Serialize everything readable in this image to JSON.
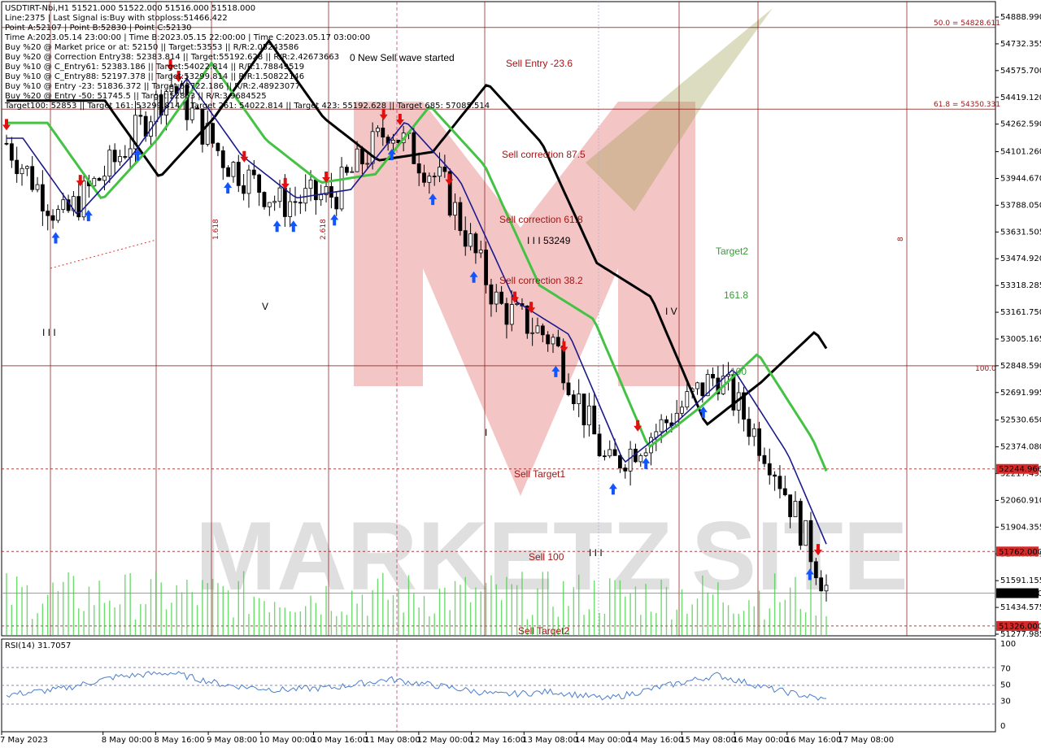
{
  "header": {
    "lines": [
      "USDTIRT-Nbi,H1  51521.000 51522.000 51516.000 51518.000",
      "Line:2375  | Last Signal is:Buy with stoploss:51466.422",
      "Point A:52107 | Point B:52830 | Point C:52130",
      "Time A:2023.05.14 23:00:00 | Time B:2023.05.15 22:00:00 | Time C:2023.05.17 03:00:00",
      "Buy %20 @ Market price or at: 52150 || Target:53553 || R/R:2.05243586",
      "Buy %20 @ Correction Entry38: 52383.814 || Target:55192.628 || R/R:2.42673663",
      "Buy %10 @ C_Entry61: 52383.186 || Target:54022.814 || R/R:1.78849519",
      "Buy %10 @ C_Entry88: 52197.378 || Target:53299.814 || R/R:1.50822146",
      "Buy %10 @ Entry -23: 51836.372 || Target:53722.186 || R/R:2.48923077",
      "Buy %20 @ Entry -50: 51745.5 || Target:52853 || R/R:3.9684525",
      "Target100: 52853 || Target 161: 53299.814 || Target 261: 54022.814 || Target 423: 55192.628 || Target 685: 57085.514"
    ]
  },
  "annotations": {
    "new_wave": "0 New Sell wave started",
    "sell_entry": "Sell Entry -23.6",
    "sell_corr_875": "Sell correction 87.5",
    "sell_corr_618": "Sell correction 61.8",
    "sell_corr_382": "Sell correction 38.2",
    "sell_target1": "Sell Target1",
    "sell_100": "Sell 100",
    "sell_target2": "Sell Target2",
    "target2": "Target2",
    "n1618": "161.8",
    "n100": "100",
    "wave_iii_price": "I I I 53249",
    "wave_iv": "I V",
    "wave_v": "V",
    "wave_iii_left": "I I I",
    "wave_i": "I",
    "wave_iii_bottom": "I I I",
    "fib_1618_vert": "1.618",
    "fib_2618_vert": "2.618",
    "num_8": "8",
    "fib_50": "50.0 = 54828.611",
    "fib_618": "61.8 = 54350.331",
    "fib_100": "100.0"
  },
  "watermark": {
    "text_left": "MARKETZ",
    "text_right": "SITE"
  },
  "price_axis": {
    "ticks": [
      "54888.990",
      "54732.355",
      "54575.700",
      "54419.120",
      "54262.590",
      "54101.260",
      "53944.670",
      "53788.050",
      "53631.505",
      "53474.920",
      "53318.285",
      "53161.750",
      "53005.165",
      "52848.590",
      "52691.995",
      "52530.650",
      "52374.080",
      "52217.495",
      "52060.910",
      "51904.355",
      "51747.785",
      "51591.155",
      "51434.575",
      "51277.985"
    ],
    "tags": [
      {
        "label": "52244.966",
        "color": "#d42a2a"
      },
      {
        "label": "51762.000",
        "color": "#d42a2a"
      },
      {
        "label": "51518.000",
        "color": "#000000"
      },
      {
        "label": "51326.000",
        "color": "#d42a2a"
      }
    ]
  },
  "time_axis": {
    "ticks": [
      "7 May 2023",
      "8 May 00:00",
      "8 May 16:00",
      "9 May 08:00",
      "10 May 00:00",
      "10 May 16:00",
      "11 May 08:00",
      "12 May 00:00",
      "12 May 16:00",
      "13 May 08:00",
      "14 May 00:00",
      "14 May 16:00",
      "15 May 08:00",
      "16 May 00:00",
      "16 May 16:00",
      "17 May 08:00"
    ]
  },
  "rsi": {
    "label": "RSI(14) 31.7057",
    "ticks": [
      "100",
      "70",
      "50",
      "30",
      "0"
    ]
  },
  "colors": {
    "ema_fast": "#1a1a8c",
    "ema_mid": "#44c244",
    "ema_slow": "#000000",
    "fib_line": "#8b1a1a",
    "rsi_line": "#4a7ecc",
    "volume": "#33cc33",
    "buy_arrow": "#1155ff",
    "sell_arrow": "#e01010"
  },
  "chart_data": [
    {
      "type": "line",
      "title": "USDTIRT-Nbi,H1",
      "ylim": [
        51277.985,
        54888.99
      ],
      "x": [
        "7 May 2023",
        "8 May 00:00",
        "8 May 16:00",
        "9 May 08:00",
        "10 May 00:00",
        "10 May 16:00",
        "11 May 08:00",
        "12 May 00:00",
        "12 May 16:00",
        "13 May 08:00",
        "14 May 00:00",
        "14 May 16:00",
        "15 May 08:00",
        "16 May 00:00",
        "16 May 16:00",
        "17 May 08:00"
      ],
      "series": [
        {
          "values": [
            54150,
            53700,
            54050,
            54500,
            54050,
            53800,
            53850,
            54250,
            53900,
            53200,
            53000,
            52250,
            52500,
            52800,
            52300,
            51550
          ]
        }
      ],
      "levels": [
        54828.611,
        54350.331,
        52848.59,
        52244.966,
        51762.0,
        51518.0,
        51326.0
      ]
    },
    {
      "type": "line",
      "title": "RSI(14) 31.7057",
      "ylim": [
        0,
        100
      ],
      "x": [
        "7 May 2023",
        "8 May 00:00",
        "8 May 16:00",
        "9 May 08:00",
        "10 May 00:00",
        "10 May 16:00",
        "11 May 08:00",
        "12 May 00:00",
        "12 May 16:00",
        "13 May 08:00",
        "14 May 00:00",
        "14 May 16:00",
        "15 May 08:00",
        "16 May 00:00",
        "16 May 16:00",
        "17 May 08:00"
      ],
      "series": [
        {
          "values": [
            38,
            45,
            60,
            65,
            50,
            44,
            47,
            57,
            48,
            38,
            42,
            33,
            48,
            62,
            45,
            31.7
          ]
        }
      ],
      "levels": [
        70,
        50,
        30
      ]
    }
  ]
}
